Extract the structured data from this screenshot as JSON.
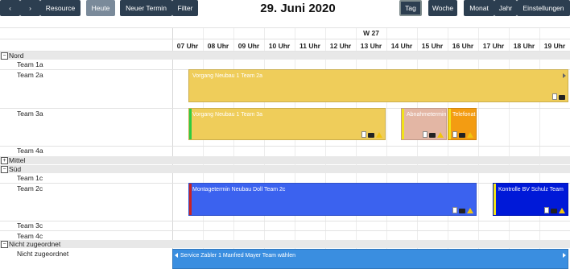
{
  "toolbar": {
    "prev_icon": "chevron-left-icon",
    "next_icon": "chevron-right-icon",
    "resource_label": "Resource",
    "today_label": "Heute",
    "new_appointment_label": "Neuer Termin",
    "filter_label": "Filter",
    "date_title": "29. Juni 2020",
    "view_day": "Tag",
    "view_week": "Woche",
    "view_month": "Monat",
    "view_year": "Jahr",
    "settings_label": "Einstellungen"
  },
  "calendar": {
    "week_label": "W 27",
    "hours": [
      "07 Uhr",
      "08 Uhr",
      "09 Uhr",
      "10 Uhr",
      "11 Uhr",
      "12 Uhr",
      "13 Uhr",
      "14 Uhr",
      "15 Uhr",
      "16 Uhr",
      "17 Uhr",
      "18 Uhr",
      "19 Uhr"
    ],
    "groups": [
      {
        "label": "Nord",
        "toggle": "−"
      },
      {
        "label": "Mittel",
        "toggle": "+"
      },
      {
        "label": "Süd",
        "toggle": "−"
      },
      {
        "label": "Nicht zugeordnet",
        "toggle": "−"
      }
    ],
    "teams": {
      "t1a": "Team 1a",
      "t2a": "Team 2a",
      "t3a": "Team 3a",
      "t4a": "Team 4a",
      "t1c": "Team 1c",
      "t2c": "Team 2c",
      "t3c": "Team 3c",
      "t4c": "Team 4c",
      "unassigned": "Nicht zugeordnet"
    },
    "events": {
      "e1": "Vorgang Neubau 1 Team 2a",
      "e2": "Vorgang Neubau 1 Team 3a",
      "e3": "Abnahmetermin",
      "e4": "Telefonat",
      "e5": "Montagetermin Neubau Doll Team 2c",
      "e6": "Kontrolle BV Schulz Team",
      "e7": "Service Zabler 1 Manfred Mayer Team wählen"
    },
    "colors": {
      "yellow": "#efcd5a",
      "salmon": "#e3b6a4",
      "orange": "#f39c12",
      "blue": "#3b62ef",
      "navy": "#0019d8",
      "lightblue": "#3a8ee0",
      "green": "#2ecc40",
      "red": "#cc2222"
    }
  }
}
